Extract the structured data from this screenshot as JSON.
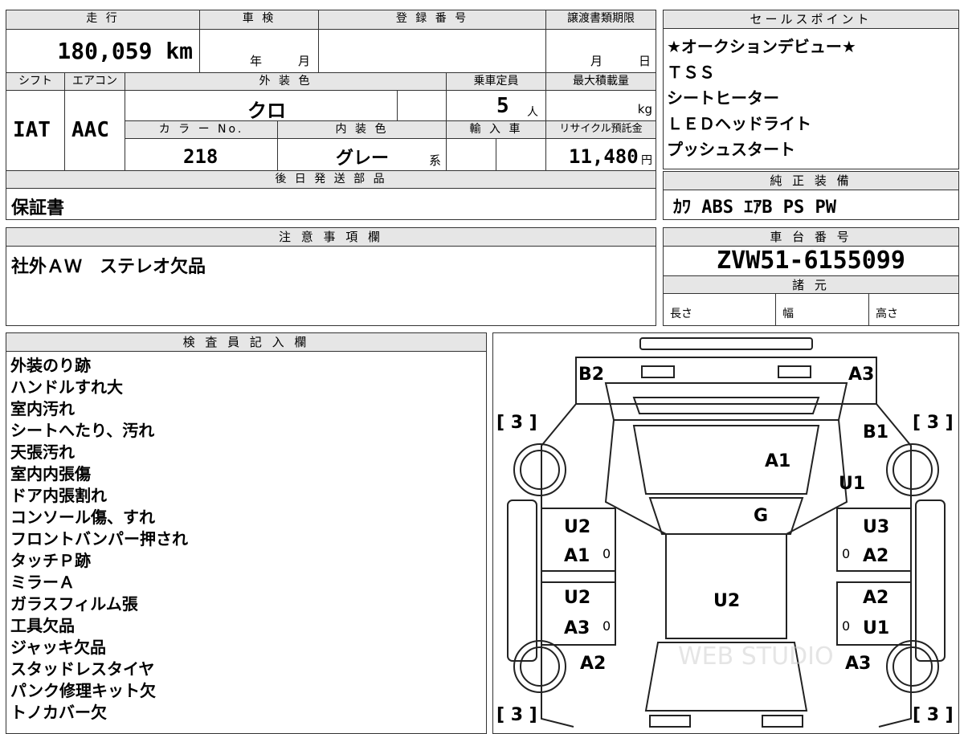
{
  "top_table": {
    "headers": {
      "mileage": "走 行",
      "shaken": "車 検",
      "registration": "登 録 番 号",
      "transfer_deadline": "譲渡書類期限",
      "shift": "シフト",
      "aircon": "エアコン",
      "exterior_color": "外 装 色",
      "capacity": "乗車定員",
      "max_load": "最大積載量",
      "color_no": "カ ラ ー No.",
      "interior_color": "内 装 色",
      "import": "輸 入 車",
      "recycle": "リサイクル預託金",
      "later_parts": "後 日 発 送 部 品"
    },
    "mileage_value": "180,059 km",
    "shaken_year_unit": "年",
    "shaken_month_unit": "月",
    "deadline_month_unit": "月",
    "deadline_day_unit": "日",
    "shift_value": "IAT",
    "aircon_value": "AAC",
    "exterior_color_value": "クロ",
    "capacity_value": "5",
    "capacity_unit": "人",
    "max_load_unit": "kg",
    "color_no_value": "218",
    "interior_color_value": "グレー",
    "interior_color_suffix": "系",
    "recycle_value": "11,480",
    "recycle_unit": "円",
    "later_parts_value": "保証書"
  },
  "sales_points": {
    "header": "セールスポイント",
    "items": [
      "★オークションデビュー★",
      "ＴＳＳ",
      "シートヒーター",
      "ＬＥＤヘッドライト",
      "プッシュスタート"
    ]
  },
  "genuine_equipment": {
    "header": "純 正 装 備",
    "value": "ｶﾜ ABS ｴｱB PS PW"
  },
  "notes": {
    "header": "注 意 事 項 欄",
    "value": "社外ＡＷ　ステレオ欠品"
  },
  "chassis": {
    "header": "車 台 番 号",
    "value": "ZVW51-6155099",
    "specs_header": "諸 元",
    "length": "長さ",
    "width": "幅",
    "height": "高さ"
  },
  "inspector": {
    "header": "検 査 員 記 入 欄",
    "lines": [
      "外装のり跡",
      "ハンドルすれ大",
      "室内汚れ",
      "シートへたり、汚れ",
      "天張汚れ",
      "室内内張傷",
      "ドア内張割れ",
      "コンソール傷、すれ",
      "フロントバンパー押され",
      "タッチＰ跡",
      "ミラーＡ",
      "ガラスフィルム張",
      "工具欠品",
      "ジャッキ欠品",
      "スタッドレスタイヤ",
      "パンク修理キット欠",
      "トノカバー欠"
    ]
  },
  "diagram": {
    "marks": [
      "B2",
      "A3",
      "B1",
      "A1",
      "U1",
      "G",
      "U2",
      "A1",
      "U3",
      "A2",
      "U2",
      "U2",
      "A3",
      "A2",
      "U1",
      "A2",
      "A3"
    ],
    "tire_brackets": [
      "[ 3 ]",
      "[ 3 ]",
      "[ 3 ]",
      "[ 3 ]"
    ],
    "zeros": [
      "0",
      "0",
      "0",
      "0"
    ],
    "watermark": "WEB STUDIO"
  }
}
